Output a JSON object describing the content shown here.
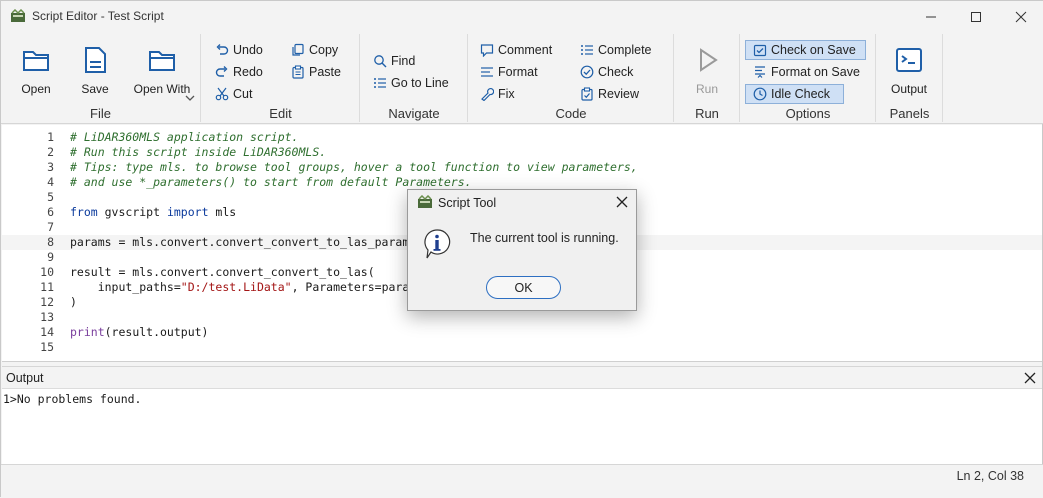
{
  "window": {
    "title": "Script Editor - Test Script"
  },
  "ribbon": {
    "file": {
      "label": "File",
      "open": "Open",
      "save": "Save",
      "open_with": "Open With"
    },
    "edit": {
      "label": "Edit",
      "undo": "Undo",
      "redo": "Redo",
      "cut": "Cut",
      "copy": "Copy",
      "paste": "Paste"
    },
    "navigate": {
      "label": "Navigate",
      "find": "Find",
      "go_to_line": "Go to Line"
    },
    "code": {
      "label": "Code",
      "comment": "Comment",
      "format": "Format",
      "fix": "Fix",
      "complete": "Complete",
      "check": "Check",
      "review": "Review"
    },
    "run": {
      "label": "Run",
      "run": "Run"
    },
    "options": {
      "label": "Options",
      "check_on_save": "Check on Save",
      "check_on_save_checked": true,
      "format_on_save": "Format on Save",
      "format_on_save_checked": false,
      "idle_check": "Idle Check",
      "idle_check_checked": true
    },
    "panels": {
      "label": "Panels",
      "output": "Output"
    }
  },
  "editor": {
    "current_line": 2,
    "lines": [
      {
        "n": "1",
        "text": "# LiDAR360MLS application script."
      },
      {
        "n": "2",
        "text": "# Run this script inside LiDAR360MLS."
      },
      {
        "n": "3",
        "text": "# Tips: type mls. to browse tool groups, hover a tool function to view parameters,"
      },
      {
        "n": "4",
        "text": "# and use *_parameters() to start from default Parameters."
      },
      {
        "n": "5",
        "text": ""
      },
      {
        "n": "6",
        "kw1": "from",
        "mid": " gvscript ",
        "kw2": "import",
        "rest": " mls"
      },
      {
        "n": "7",
        "text": ""
      },
      {
        "n": "8",
        "text": "params = mls.convert.convert_convert_to_las_parameters()"
      },
      {
        "n": "9",
        "text": ""
      },
      {
        "n": "10",
        "text": "result = mls.convert.convert_convert_to_las("
      },
      {
        "n": "11",
        "pre": "    input_paths=",
        "str": "\"D:/test.LiData\"",
        "post": ", Parameters=params"
      },
      {
        "n": "12",
        "text": ")"
      },
      {
        "n": "13",
        "text": ""
      },
      {
        "n": "14",
        "fn": "print",
        "rest": "(result.output)"
      },
      {
        "n": "15",
        "text": ""
      }
    ]
  },
  "output": {
    "title": "Output",
    "lines": [
      "1>No problems found."
    ]
  },
  "status": {
    "position": "Ln 2, Col 38"
  },
  "dialog": {
    "title": "Script Tool",
    "message": "The current tool is running.",
    "ok_label": "OK"
  }
}
